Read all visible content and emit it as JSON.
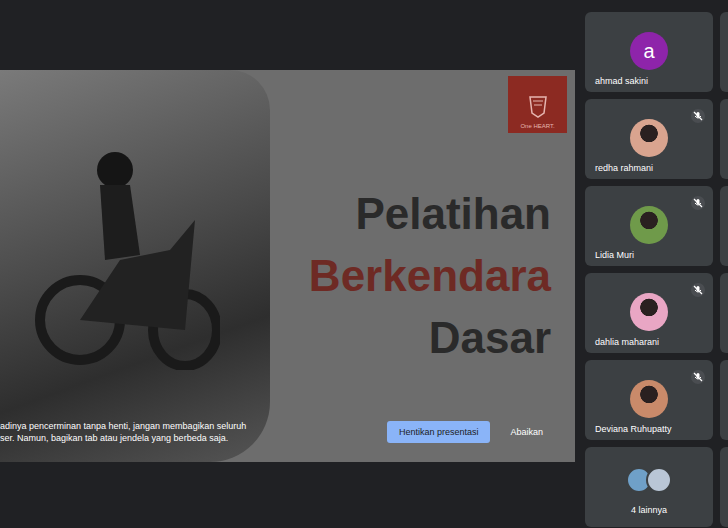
{
  "presentation": {
    "logo_text": "One HEART.",
    "title_lines": [
      {
        "text": "Pelatihan",
        "color": "#2a2a2a"
      },
      {
        "text": "Berkendara",
        "color": "#6e2a24"
      },
      {
        "text": "Dasar",
        "color": "#2a2a2a"
      }
    ],
    "warning_lines": [
      "adinya pencerminan tanpa henti, jangan membagikan seluruh",
      "ser. Namun, bagikan tab atau jendela yang berbeda saja."
    ],
    "stop_button": "Hentikan presentasi",
    "dismiss_button": "Abaikan"
  },
  "participants": [
    {
      "name": "ahmad sakini",
      "kind": "initial",
      "initial": "a",
      "muted": false,
      "color": "#8e24aa"
    },
    {
      "name": "redha rahmani",
      "kind": "photo",
      "muted": true,
      "color": "#d9a48f"
    },
    {
      "name": "Lidia Muri",
      "kind": "photo",
      "muted": true,
      "color": "#6f9a4a"
    },
    {
      "name": "dahlia maharani",
      "kind": "photo",
      "muted": true,
      "color": "#e9a6c4"
    },
    {
      "name": "Deviana Ruhupatty",
      "kind": "photo",
      "muted": true,
      "color": "#c98a6a"
    }
  ],
  "others": {
    "label": "4 lainnya",
    "colors": [
      "#6fa0c8",
      "#b9c6d6"
    ]
  }
}
